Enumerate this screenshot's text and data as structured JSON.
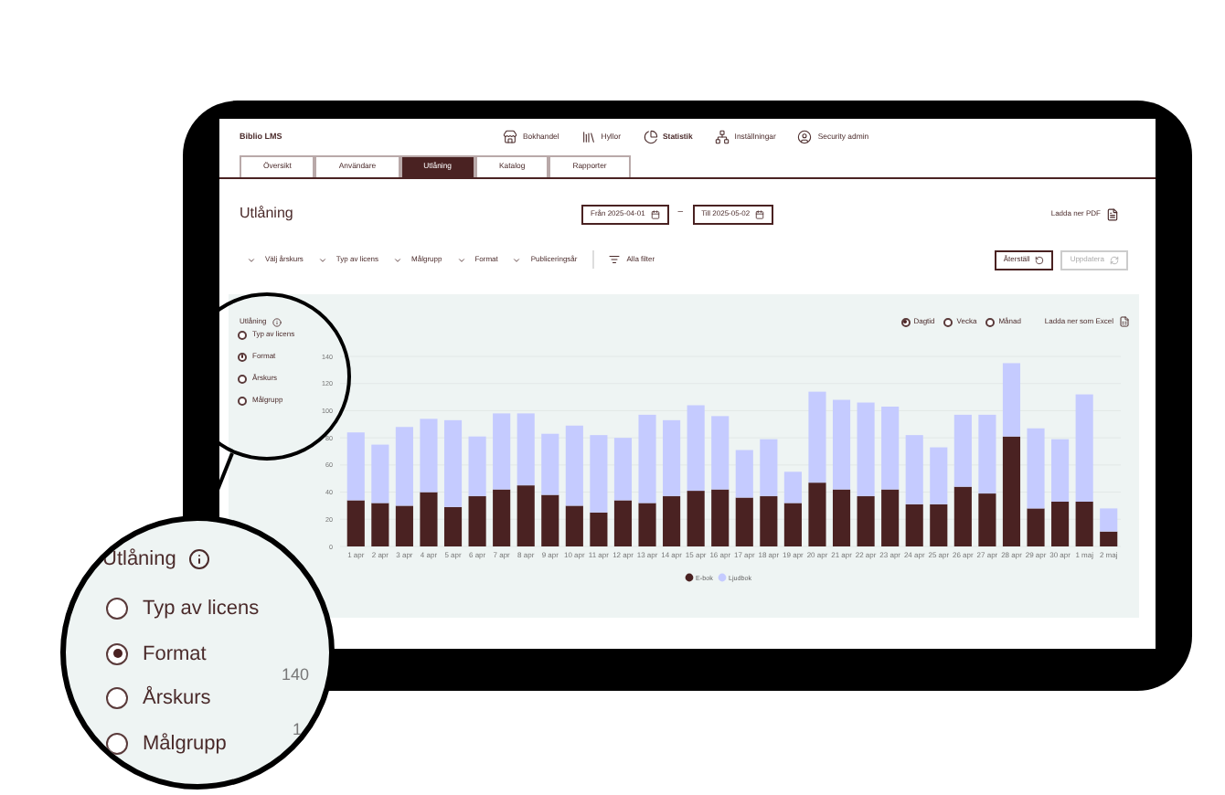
{
  "app": {
    "title": "Biblio LMS"
  },
  "top_nav": [
    {
      "label": "Bokhandel",
      "selected": false
    },
    {
      "label": "Hyllor",
      "selected": false
    },
    {
      "label": "Statistik",
      "selected": true
    },
    {
      "label": "Inställningar",
      "selected": false
    },
    {
      "label": "Security admin",
      "selected": false
    }
  ],
  "tabs": [
    {
      "label": "Översikt",
      "selected": false
    },
    {
      "label": "Användare",
      "selected": false
    },
    {
      "label": "Utlåning",
      "selected": true
    },
    {
      "label": "Katalog",
      "selected": false
    },
    {
      "label": "Rapporter",
      "selected": false
    }
  ],
  "page": {
    "title": "Utlåning",
    "date_from": "Från 2025-04-01",
    "separator": "–",
    "date_to": "Till 2025-05-02",
    "pdf_link": "Ladda ner PDF"
  },
  "filters": [
    "Välj årskurs",
    "Typ av licens",
    "Målgrupp",
    "Format",
    "Publiceringsår"
  ],
  "all_filters": "Alla filter",
  "reset_button": {
    "label": "Återställ",
    "disabled": false
  },
  "update_button": {
    "label": "Uppdatera",
    "disabled": true
  },
  "panel": {
    "title": "Utlåning",
    "group_by": [
      {
        "label": "Typ av licens",
        "selected": false
      },
      {
        "label": "Format",
        "selected": true
      },
      {
        "label": "Årskurs",
        "selected": false
      },
      {
        "label": "Målgrupp",
        "selected": false
      }
    ],
    "periods": [
      {
        "label": "Dagtid",
        "selected": true
      },
      {
        "label": "Vecka",
        "selected": false
      },
      {
        "label": "Månad",
        "selected": false
      }
    ],
    "excel_link": "Ladda ner som Excel",
    "chart_data": {
      "type": "bar",
      "stacked": true,
      "categories": [
        "1 apr",
        "2 apr",
        "3 apr",
        "4 apr",
        "5 apr",
        "6 apr",
        "7 apr",
        "8 apr",
        "9 apr",
        "10 apr",
        "11 apr",
        "12 apr",
        "13 apr",
        "14 apr",
        "15 apr",
        "16 apr",
        "17 apr",
        "18 apr",
        "19 apr",
        "20 apr",
        "21 apr",
        "22 apr",
        "23 apr",
        "24 apr",
        "25 apr",
        "26 apr",
        "27 apr",
        "28 apr",
        "29 apr",
        "30 apr",
        "1 maj",
        "2 maj"
      ],
      "series": [
        {
          "name": "E-bok",
          "color": "#4a2222",
          "values": [
            34,
            32,
            30,
            40,
            29,
            37,
            42,
            45,
            38,
            30,
            25,
            34,
            32,
            37,
            41,
            42,
            36,
            37,
            32,
            47,
            42,
            37,
            42,
            31,
            31,
            44,
            39,
            81,
            28,
            33,
            33,
            11
          ]
        },
        {
          "name": "Ljudbok",
          "color": "#c5cbff",
          "values": [
            50,
            43,
            58,
            54,
            64,
            44,
            56,
            53,
            45,
            59,
            57,
            46,
            65,
            56,
            63,
            54,
            35,
            42,
            23,
            67,
            66,
            69,
            61,
            51,
            42,
            53,
            58,
            54,
            59,
            46,
            79,
            17
          ]
        }
      ],
      "ylim": [
        0,
        140
      ],
      "yticks": [
        0,
        20,
        40,
        60,
        80,
        100,
        120,
        140
      ],
      "grid": true,
      "legend": true
    }
  },
  "magnifier": {
    "title": "Utlåning",
    "options": [
      {
        "label": "Typ av licens",
        "selected": false
      },
      {
        "label": "Format",
        "selected": true
      },
      {
        "label": "Årskurs",
        "selected": false
      },
      {
        "label": "Målgrupp",
        "selected": false
      }
    ],
    "tick": "140",
    "tick_partial": "1"
  }
}
